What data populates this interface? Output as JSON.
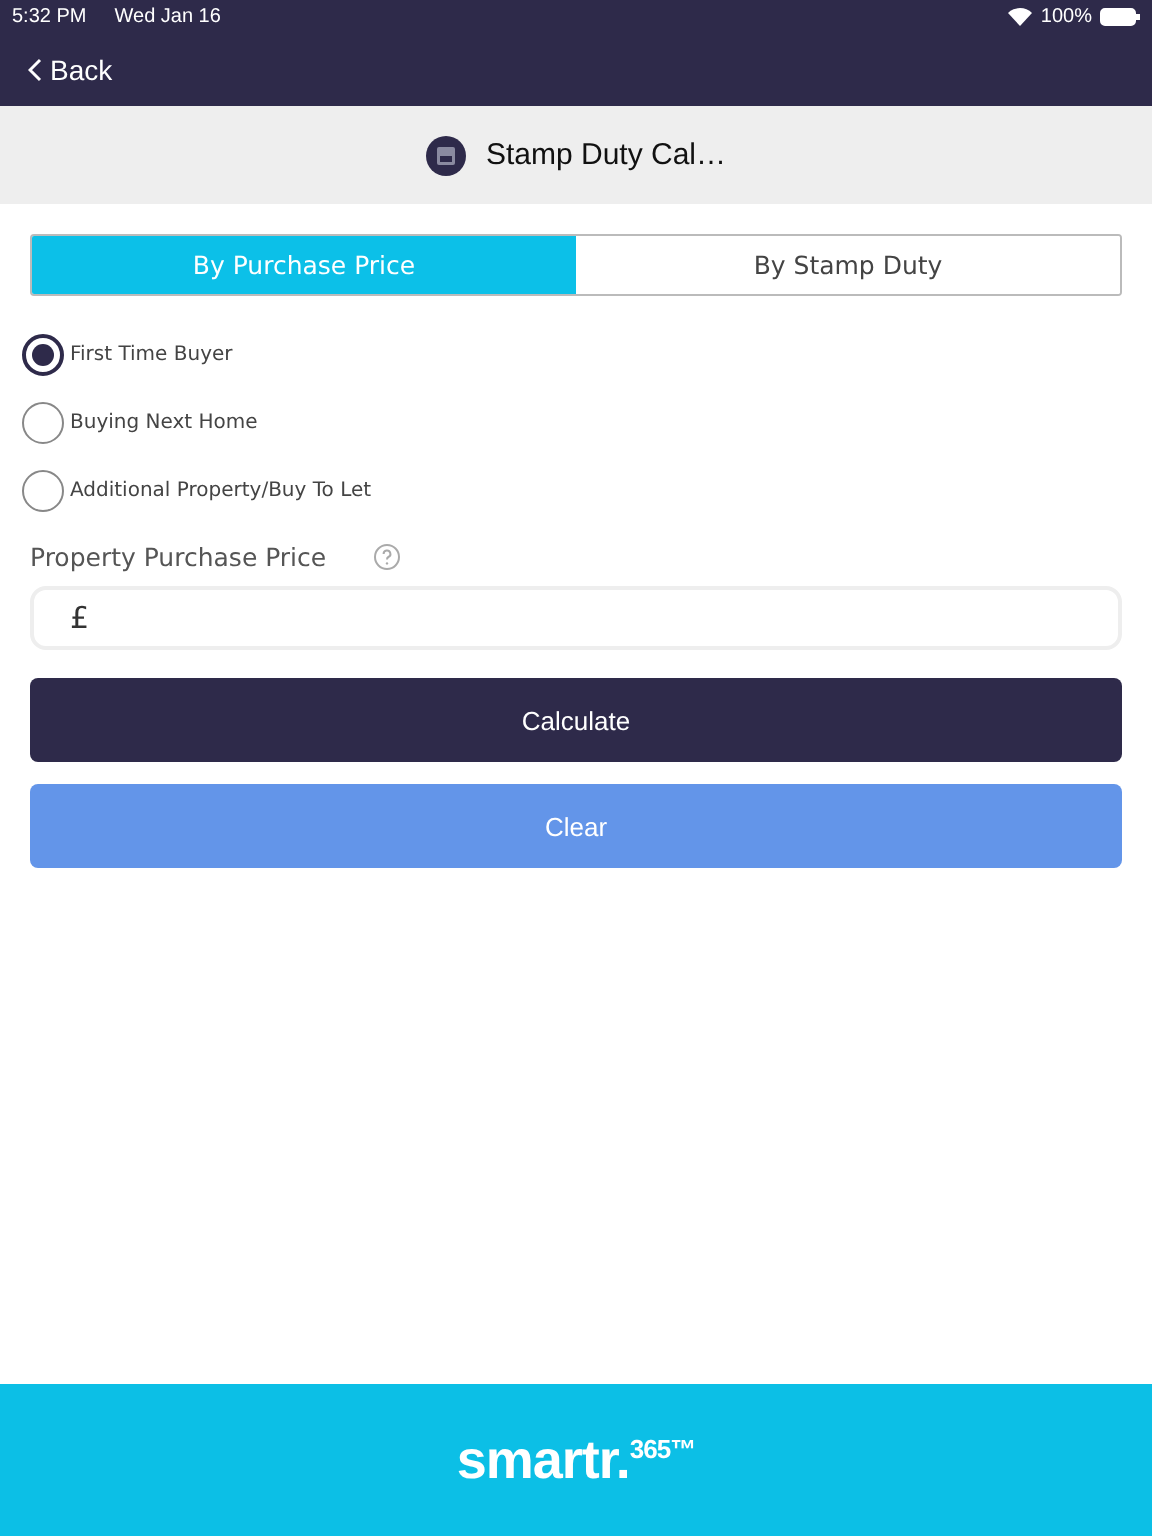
{
  "status_bar": {
    "time": "5:32 PM",
    "date": "Wed Jan 16",
    "battery": "100%"
  },
  "nav": {
    "back": "Back"
  },
  "title": "Stamp Duty Cal…",
  "tabs": [
    {
      "label": "By Purchase Price",
      "selected": true
    },
    {
      "label": "By Stamp Duty",
      "selected": false
    }
  ],
  "options": [
    {
      "label": "First Time Buyer",
      "selected": true
    },
    {
      "label": "Buying Next Home",
      "selected": false
    },
    {
      "label": "Additional Property/Buy To Let",
      "selected": false
    }
  ],
  "price_field": {
    "label": "Property Purchase Price",
    "value": "£"
  },
  "buttons": [
    {
      "label": "Calculate",
      "kind": "primary"
    },
    {
      "label": "Clear",
      "kind": "secondary"
    }
  ],
  "footer": {
    "logo": "smartr.$^{365™}$"
  }
}
